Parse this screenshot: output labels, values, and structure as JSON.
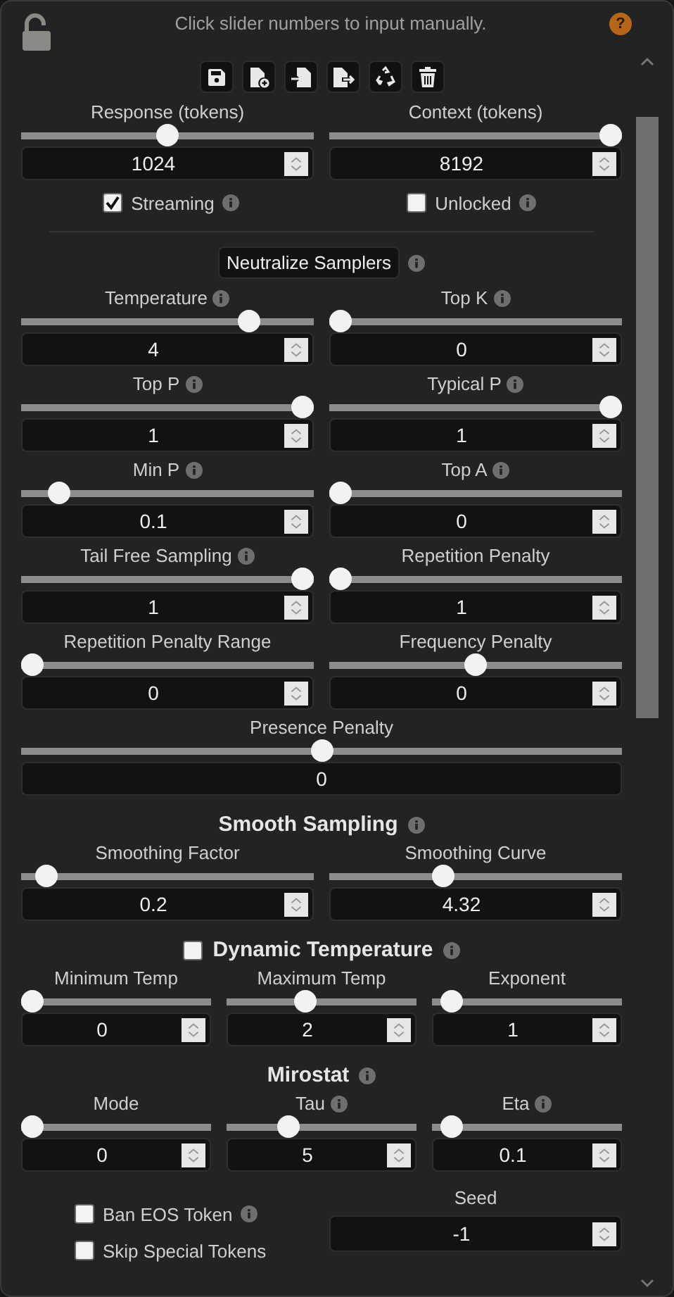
{
  "hint": "Click slider numbers to input manually.",
  "help": "?",
  "toolbar": [
    {
      "kind": "save"
    },
    {
      "kind": "new"
    },
    {
      "kind": "import"
    },
    {
      "kind": "export"
    },
    {
      "kind": "restore"
    },
    {
      "kind": "delete"
    }
  ],
  "top_sliders": [
    {
      "label": "Response (tokens)",
      "info": false,
      "value": "1024",
      "level": 0.5,
      "spinner": true
    },
    {
      "label": "Context (tokens)",
      "info": false,
      "value": "8192",
      "level": 1,
      "spinner": true
    }
  ],
  "top_checks": [
    {
      "label": "Streaming",
      "checked": true,
      "info": true
    },
    {
      "label": "Unlocked",
      "checked": false,
      "info": true
    }
  ],
  "neutralize": {
    "label": "Neutralize Samplers",
    "info": true
  },
  "samplers": [
    {
      "label": "Temperature",
      "info": true,
      "value": "4",
      "level": 0.8,
      "spinner": true
    },
    {
      "label": "Top K",
      "info": true,
      "value": "0",
      "level": 0,
      "spinner": true
    },
    {
      "label": "Top P",
      "info": true,
      "value": "1",
      "level": 1,
      "spinner": true
    },
    {
      "label": "Typical P",
      "info": true,
      "value": "1",
      "level": 1,
      "spinner": true
    },
    {
      "label": "Min P",
      "info": true,
      "value": "0.1",
      "level": 0.1,
      "spinner": true
    },
    {
      "label": "Top A",
      "info": true,
      "value": "0",
      "level": 0,
      "spinner": true
    },
    {
      "label": "Tail Free Sampling",
      "info": true,
      "value": "1",
      "level": 1,
      "spinner": true
    },
    {
      "label": "Repetition Penalty",
      "info": false,
      "value": "1",
      "level": 0,
      "spinner": true
    },
    {
      "label": "Repetition Penalty Range",
      "info": false,
      "value": "0",
      "level": 0,
      "spinner": true
    },
    {
      "label": "Frequency Penalty",
      "info": false,
      "value": "0",
      "level": 0.5,
      "spinner": true
    }
  ],
  "presence": {
    "label": "Presence Penalty",
    "info": false,
    "value": "0",
    "level": 0.5,
    "spinner": false
  },
  "smooth": {
    "title": "Smooth Sampling",
    "info": true,
    "sliders": [
      {
        "label": "Smoothing Factor",
        "info": false,
        "value": "0.2",
        "level": 0.05,
        "spinner": true
      },
      {
        "label": "Smoothing Curve",
        "info": false,
        "value": "4.32",
        "level": 0.38,
        "spinner": true
      }
    ]
  },
  "dynatemp": {
    "title": "Dynamic Temperature",
    "checked": false,
    "info": true,
    "sliders": [
      {
        "label": "Minimum Temp",
        "info": false,
        "value": "0",
        "level": 0,
        "spinner": true
      },
      {
        "label": "Maximum Temp",
        "info": false,
        "value": "2",
        "level": 0.4,
        "spinner": true
      },
      {
        "label": "Exponent",
        "info": false,
        "value": "1",
        "level": 0.05,
        "spinner": true
      }
    ]
  },
  "mirostat": {
    "title": "Mirostat",
    "info": true,
    "sliders": [
      {
        "label": "Mode",
        "info": false,
        "value": "0",
        "level": 0,
        "spinner": true
      },
      {
        "label": "Tau",
        "info": true,
        "value": "5",
        "level": 0.3,
        "spinner": true
      },
      {
        "label": "Eta",
        "info": true,
        "value": "0.1",
        "level": 0.05,
        "spinner": true
      }
    ]
  },
  "bottom_checks": [
    {
      "label": "Ban EOS Token",
      "checked": false,
      "info": true
    },
    {
      "label": "Skip Special Tokens",
      "checked": false,
      "info": false
    }
  ],
  "seed": {
    "label": "Seed",
    "value": "-1"
  }
}
